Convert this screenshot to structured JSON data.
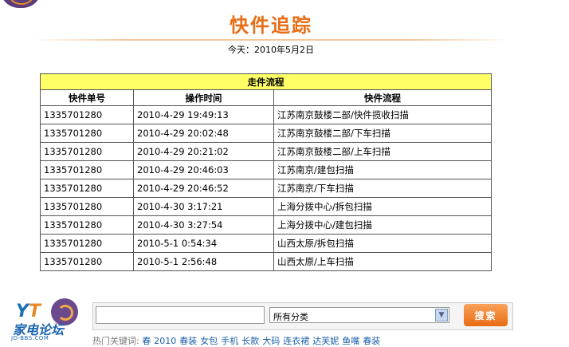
{
  "page": {
    "title": "快件追踪",
    "today": "今天：2010年5月2日"
  },
  "table": {
    "caption": "走件流程",
    "headers": [
      "快件单号",
      "操作时间",
      "快件流程"
    ],
    "rows": [
      [
        "1335701280",
        "2010-4-29 19:49:13",
        "江苏南京鼓楼二部/快件揽收扫描"
      ],
      [
        "1335701280",
        "2010-4-29 20:02:48",
        "江苏南京鼓楼二部/下车扫描"
      ],
      [
        "1335701280",
        "2010-4-29 20:21:02",
        "江苏南京鼓楼二部/上车扫描"
      ],
      [
        "1335701280",
        "2010-4-29 20:46:03",
        "江苏南京/建包扫描"
      ],
      [
        "1335701280",
        "2010-4-29 20:46:52",
        "江苏南京/下车扫描"
      ],
      [
        "1335701280",
        "2010-4-30 3:17:21",
        "上海分拨中心/拆包扫描"
      ],
      [
        "1335701280",
        "2010-4-30 3:27:54",
        "上海分拨中心/建包扫描"
      ],
      [
        "1335701280",
        "2010-5-1 0:54:34",
        "山西太原/拆包扫描"
      ],
      [
        "1335701280",
        "2010-5-1 2:56:48",
        "山西太原/上车扫描"
      ]
    ]
  },
  "footer": {
    "logo_text": "家电论坛",
    "logo_url_text": "JD-BBS.COM",
    "search_value": "",
    "category_selected": "所有分类",
    "search_button": "搜索",
    "hot_label": "热门关键词:",
    "hot_keywords": [
      "春",
      "2010",
      "春装",
      "女包",
      "手机",
      "长款",
      "大码",
      "连衣裙",
      "达芙妮",
      "鱼嘴",
      "春装"
    ]
  },
  "colors": {
    "title": "#e96d14",
    "caption_bg": "#ffff66",
    "button": "#e96a12",
    "link": "#1a5ea8"
  }
}
